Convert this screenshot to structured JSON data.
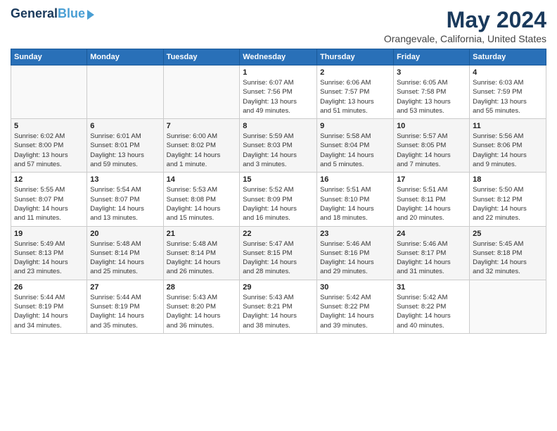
{
  "header": {
    "logo_line1": "General",
    "logo_line2": "Blue",
    "title": "May 2024",
    "subtitle": "Orangevale, California, United States"
  },
  "weekdays": [
    "Sunday",
    "Monday",
    "Tuesday",
    "Wednesday",
    "Thursday",
    "Friday",
    "Saturday"
  ],
  "weeks": [
    [
      {
        "day": "",
        "info": ""
      },
      {
        "day": "",
        "info": ""
      },
      {
        "day": "",
        "info": ""
      },
      {
        "day": "1",
        "info": "Sunrise: 6:07 AM\nSunset: 7:56 PM\nDaylight: 13 hours\nand 49 minutes."
      },
      {
        "day": "2",
        "info": "Sunrise: 6:06 AM\nSunset: 7:57 PM\nDaylight: 13 hours\nand 51 minutes."
      },
      {
        "day": "3",
        "info": "Sunrise: 6:05 AM\nSunset: 7:58 PM\nDaylight: 13 hours\nand 53 minutes."
      },
      {
        "day": "4",
        "info": "Sunrise: 6:03 AM\nSunset: 7:59 PM\nDaylight: 13 hours\nand 55 minutes."
      }
    ],
    [
      {
        "day": "5",
        "info": "Sunrise: 6:02 AM\nSunset: 8:00 PM\nDaylight: 13 hours\nand 57 minutes."
      },
      {
        "day": "6",
        "info": "Sunrise: 6:01 AM\nSunset: 8:01 PM\nDaylight: 13 hours\nand 59 minutes."
      },
      {
        "day": "7",
        "info": "Sunrise: 6:00 AM\nSunset: 8:02 PM\nDaylight: 14 hours\nand 1 minute."
      },
      {
        "day": "8",
        "info": "Sunrise: 5:59 AM\nSunset: 8:03 PM\nDaylight: 14 hours\nand 3 minutes."
      },
      {
        "day": "9",
        "info": "Sunrise: 5:58 AM\nSunset: 8:04 PM\nDaylight: 14 hours\nand 5 minutes."
      },
      {
        "day": "10",
        "info": "Sunrise: 5:57 AM\nSunset: 8:05 PM\nDaylight: 14 hours\nand 7 minutes."
      },
      {
        "day": "11",
        "info": "Sunrise: 5:56 AM\nSunset: 8:06 PM\nDaylight: 14 hours\nand 9 minutes."
      }
    ],
    [
      {
        "day": "12",
        "info": "Sunrise: 5:55 AM\nSunset: 8:07 PM\nDaylight: 14 hours\nand 11 minutes."
      },
      {
        "day": "13",
        "info": "Sunrise: 5:54 AM\nSunset: 8:07 PM\nDaylight: 14 hours\nand 13 minutes."
      },
      {
        "day": "14",
        "info": "Sunrise: 5:53 AM\nSunset: 8:08 PM\nDaylight: 14 hours\nand 15 minutes."
      },
      {
        "day": "15",
        "info": "Sunrise: 5:52 AM\nSunset: 8:09 PM\nDaylight: 14 hours\nand 16 minutes."
      },
      {
        "day": "16",
        "info": "Sunrise: 5:51 AM\nSunset: 8:10 PM\nDaylight: 14 hours\nand 18 minutes."
      },
      {
        "day": "17",
        "info": "Sunrise: 5:51 AM\nSunset: 8:11 PM\nDaylight: 14 hours\nand 20 minutes."
      },
      {
        "day": "18",
        "info": "Sunrise: 5:50 AM\nSunset: 8:12 PM\nDaylight: 14 hours\nand 22 minutes."
      }
    ],
    [
      {
        "day": "19",
        "info": "Sunrise: 5:49 AM\nSunset: 8:13 PM\nDaylight: 14 hours\nand 23 minutes."
      },
      {
        "day": "20",
        "info": "Sunrise: 5:48 AM\nSunset: 8:14 PM\nDaylight: 14 hours\nand 25 minutes."
      },
      {
        "day": "21",
        "info": "Sunrise: 5:48 AM\nSunset: 8:14 PM\nDaylight: 14 hours\nand 26 minutes."
      },
      {
        "day": "22",
        "info": "Sunrise: 5:47 AM\nSunset: 8:15 PM\nDaylight: 14 hours\nand 28 minutes."
      },
      {
        "day": "23",
        "info": "Sunrise: 5:46 AM\nSunset: 8:16 PM\nDaylight: 14 hours\nand 29 minutes."
      },
      {
        "day": "24",
        "info": "Sunrise: 5:46 AM\nSunset: 8:17 PM\nDaylight: 14 hours\nand 31 minutes."
      },
      {
        "day": "25",
        "info": "Sunrise: 5:45 AM\nSunset: 8:18 PM\nDaylight: 14 hours\nand 32 minutes."
      }
    ],
    [
      {
        "day": "26",
        "info": "Sunrise: 5:44 AM\nSunset: 8:19 PM\nDaylight: 14 hours\nand 34 minutes."
      },
      {
        "day": "27",
        "info": "Sunrise: 5:44 AM\nSunset: 8:19 PM\nDaylight: 14 hours\nand 35 minutes."
      },
      {
        "day": "28",
        "info": "Sunrise: 5:43 AM\nSunset: 8:20 PM\nDaylight: 14 hours\nand 36 minutes."
      },
      {
        "day": "29",
        "info": "Sunrise: 5:43 AM\nSunset: 8:21 PM\nDaylight: 14 hours\nand 38 minutes."
      },
      {
        "day": "30",
        "info": "Sunrise: 5:42 AM\nSunset: 8:22 PM\nDaylight: 14 hours\nand 39 minutes."
      },
      {
        "day": "31",
        "info": "Sunrise: 5:42 AM\nSunset: 8:22 PM\nDaylight: 14 hours\nand 40 minutes."
      },
      {
        "day": "",
        "info": ""
      }
    ]
  ]
}
